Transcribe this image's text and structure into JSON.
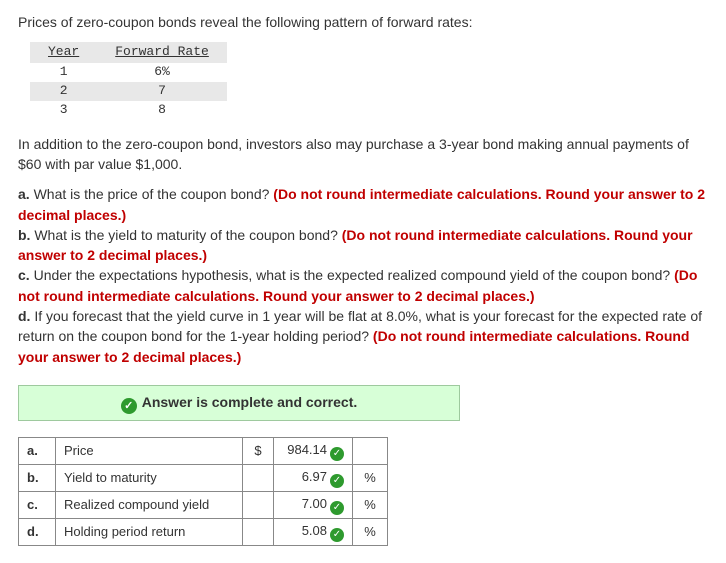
{
  "intro": "Prices of zero-coupon bonds reveal the following pattern of forward rates:",
  "forward": {
    "headers": {
      "year": "Year",
      "rate": "Forward Rate"
    },
    "rows": [
      {
        "year": "1",
        "rate": "6%"
      },
      {
        "year": "2",
        "rate": "7"
      },
      {
        "year": "3",
        "rate": "8"
      }
    ]
  },
  "intro2": "In addition to the zero-coupon bond, investors also may purchase a 3-year bond making annual payments of $60 with par value $1,000.",
  "q": {
    "a_pre": "a.",
    "a_txt": " What is the price of the coupon bond? ",
    "a_red": "(Do not round intermediate calculations. Round your answer to 2 decimal places.)",
    "b_pre": "b.",
    "b_txt": " What is the yield to maturity of the coupon bond? ",
    "b_red": "(Do not round intermediate calculations. Round your answer to 2 decimal places.)",
    "c_pre": "c.",
    "c_txt": " Under the expectations hypothesis, what is the expected realized compound yield of the coupon bond? ",
    "c_red": "(Do not round intermediate calculations. Round your answer to 2 decimal places.)",
    "d_pre": "d.",
    "d_txt": " If you forecast that the yield curve in 1 year will be flat at 8.0%, what is your forecast for the expected rate of return on the coupon bond for the 1-year holding period? ",
    "d_red": "(Do not round intermediate calculations. Round your answer to 2 decimal places.)"
  },
  "banner": "Answer is complete and correct.",
  "answers": {
    "rows": [
      {
        "label": "a.",
        "desc": "Price",
        "dollar": "$",
        "val": "984.14",
        "unit": ""
      },
      {
        "label": "b.",
        "desc": "Yield to maturity",
        "dollar": "",
        "val": "6.97",
        "unit": "%"
      },
      {
        "label": "c.",
        "desc": "Realized compound yield",
        "dollar": "",
        "val": "7.00",
        "unit": "%"
      },
      {
        "label": "d.",
        "desc": "Holding period return",
        "dollar": "",
        "val": "5.08",
        "unit": "%"
      }
    ]
  }
}
